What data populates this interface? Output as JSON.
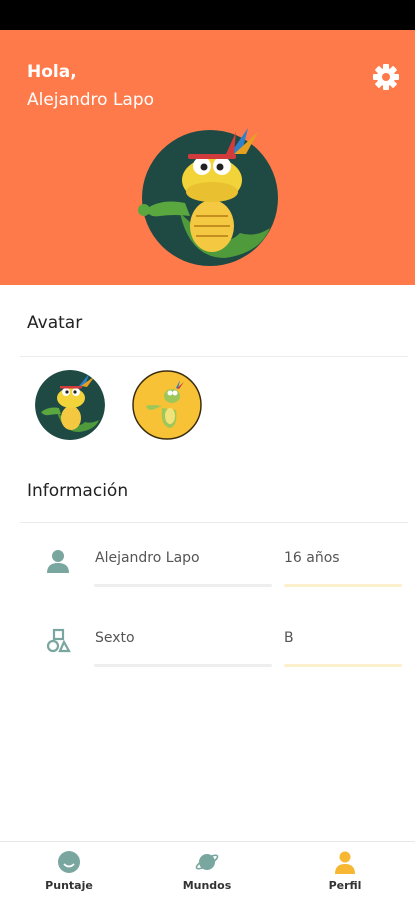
{
  "header": {
    "greeting": "Hola,",
    "user_name": "Alejandro Lapo",
    "settings_icon": "gear-icon",
    "background_color": "#ff7a4a"
  },
  "avatar_section": {
    "title": "Avatar",
    "options": [
      {
        "icon": "dino-mascot-teal",
        "selected": true
      },
      {
        "icon": "dino-mascot-yellow",
        "selected": false
      }
    ]
  },
  "info_section": {
    "title": "Información",
    "rows": [
      {
        "icon": "person-icon",
        "primary": "Alejandro Lapo",
        "secondary": "16 años"
      },
      {
        "icon": "shapes-icon",
        "primary": "Sexto",
        "secondary": "B"
      }
    ]
  },
  "bottom_nav": {
    "items": [
      {
        "label": "Puntaje",
        "icon": "face-icon"
      },
      {
        "label": "Mundos",
        "icon": "planet-icon"
      },
      {
        "label": "Perfil",
        "icon": "person-icon",
        "active": true
      }
    ],
    "active_color": "#f7b733"
  }
}
